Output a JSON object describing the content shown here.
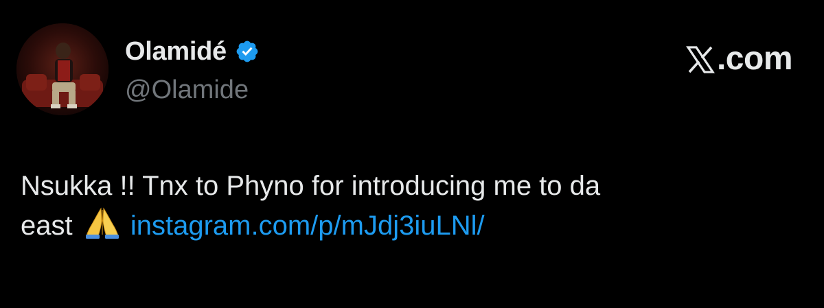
{
  "tweet": {
    "author": {
      "display_name": "Olamidé",
      "handle": "@Olamide",
      "verified": true,
      "avatar_icon": "profile-photo"
    },
    "brand": {
      "logo_text": ".com",
      "logo_icon": "x-logo-icon"
    },
    "body": {
      "line1": "Nsukka !! Tnx to Phyno for introducing me to da",
      "line2_prefix": "east",
      "emoji_icon": "folded-hands-icon",
      "link_text": "instagram.com/p/mJdj3iuLNl/"
    },
    "colors": {
      "background": "#000000",
      "text": "#e7e9ea",
      "muted": "#71767b",
      "link": "#1d9bf0",
      "verified": "#1d9bf0"
    }
  }
}
